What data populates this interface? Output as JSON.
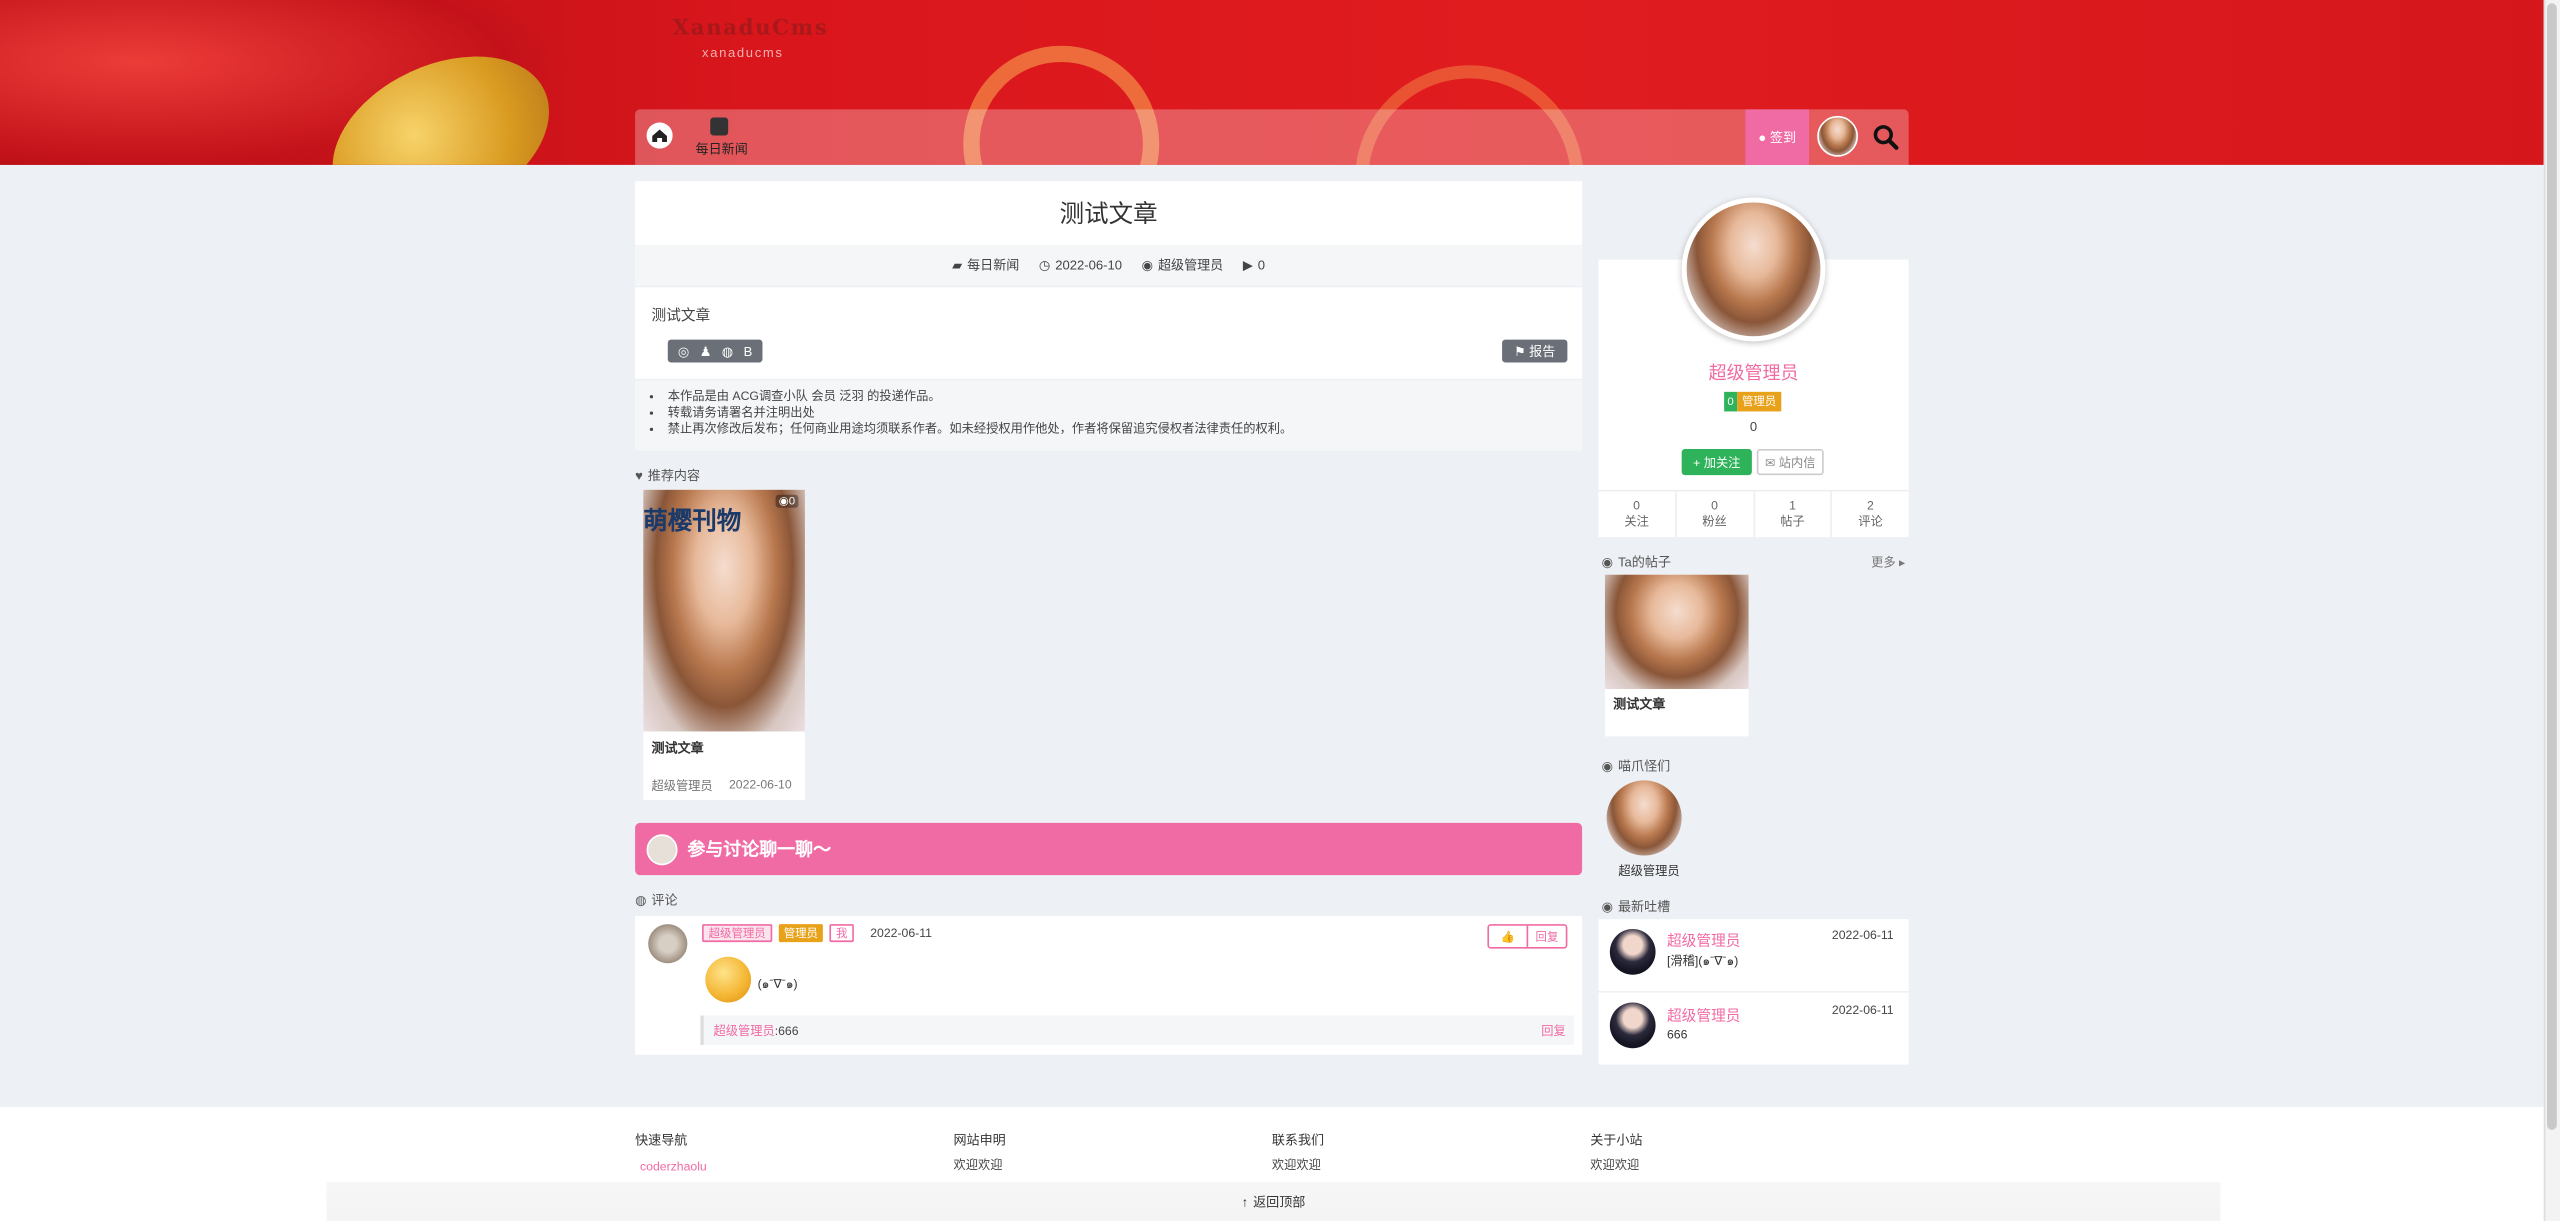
{
  "site": {
    "logo": "XanaduCms",
    "logo_sub": "xanaducms"
  },
  "nav": {
    "items": [
      {
        "label": "每日新闻"
      }
    ],
    "checkin": "签到"
  },
  "article": {
    "title": "测试文章",
    "category": "每日新闻",
    "date": "2022-06-10",
    "author": "超级管理员",
    "views": "0",
    "content": "测试文章",
    "report": "报告",
    "share_b": "B",
    "notes": [
      "本作品是由 ACG调查小队 会员 泛羽 的投递作品。",
      "转载请务请署名并注明出处",
      "禁止再次修改后发布；任何商业用途均须联系作者。如未经授权用作他处，作者将保留追究侵权者法律责任的权利。"
    ]
  },
  "recommend": {
    "label": "推荐内容",
    "item": {
      "title": "测试文章",
      "author": "超级管理员",
      "date": "2022-06-10",
      "views": "0"
    },
    "cover_text": "萌樱刊物"
  },
  "discuss": {
    "banner": "参与讨论聊一聊～",
    "label": "评论"
  },
  "comment": {
    "user": "超级管理员",
    "role": "管理员",
    "me": "我",
    "date": "2022-06-11",
    "text": "(๑ˉ∇ˉ๑)",
    "like": "👍",
    "reply": "回复",
    "quote_user": "超级管理员",
    "quote_text": ":666",
    "quote_reply": "回复"
  },
  "sidebar": {
    "name": "超级管理员",
    "level": "0",
    "role": "管理员",
    "score": "0",
    "follow": "加关注",
    "message": "站内信",
    "stats": [
      {
        "value": "0",
        "label": "关注"
      },
      {
        "value": "0",
        "label": "粉丝"
      },
      {
        "value": "1",
        "label": "帖子"
      },
      {
        "value": "2",
        "label": "评论"
      }
    ],
    "posts_label": "Ta的帖子",
    "more": "更多",
    "post_title": "测试文章",
    "guys_label": "喵爪怪们",
    "guy_name": "超级管理员",
    "tucao_label": "最新吐槽",
    "tucao": [
      {
        "user": "超级管理员",
        "date": "2022-06-11",
        "text": "[滑稽](๑ˉ∇ˉ๑)"
      },
      {
        "user": "超级管理员",
        "date": "2022-06-11",
        "text": "666"
      }
    ]
  },
  "footer": {
    "cols": [
      {
        "title": "快速导航",
        "link": "coderzhaolu"
      },
      {
        "title": "网站申明",
        "link": "欢迎欢迎"
      },
      {
        "title": "联系我们",
        "link": "欢迎欢迎"
      },
      {
        "title": "关于小站",
        "link": "欢迎欢迎"
      }
    ],
    "back_top": "返回顶部"
  },
  "colors": {
    "accent": "#f06ba4",
    "hero": "#d9161c",
    "follow": "#2fb35a",
    "role_badge": "#e8a21a"
  }
}
